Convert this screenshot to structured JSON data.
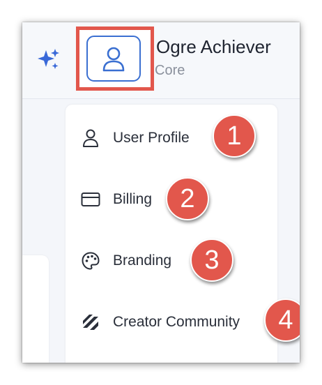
{
  "header": {
    "app_icon": "sparkle-icon",
    "avatar_icon": "user-icon",
    "user_name": "Ogre Achiever",
    "user_plan": "Core"
  },
  "menu": {
    "items": [
      {
        "label": "User Profile",
        "icon": "user-icon",
        "badge": "1"
      },
      {
        "label": "Billing",
        "icon": "credit-card-icon",
        "badge": "2"
      },
      {
        "label": "Branding",
        "icon": "palette-icon",
        "badge": "3"
      },
      {
        "label": "Creator Community",
        "icon": "community-logo-icon",
        "badge": "4"
      }
    ]
  },
  "colors": {
    "accent": "#3a6fd1",
    "highlight": "#e2574c",
    "text": "#2a2f3a",
    "muted": "#8a909c"
  }
}
